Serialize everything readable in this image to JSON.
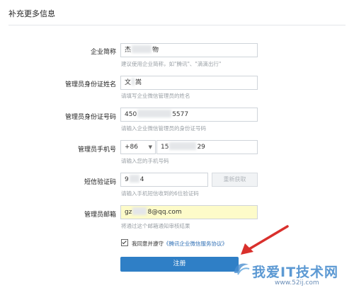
{
  "section": {
    "title": "补充更多信息"
  },
  "fields": {
    "company_name": {
      "label": "企业简称",
      "value_prefix": "杰",
      "value_suffix": "物",
      "hint": "建议使用企业简称，如\"腾讯\"、\"滴滴出行\""
    },
    "admin_name": {
      "label": "管理员身份证姓名",
      "value_prefix": "文",
      "value_suffix": "嵩",
      "hint": "请填写企业微信管理员的姓名"
    },
    "admin_id": {
      "label": "管理员身份证号码",
      "value_prefix": "450",
      "value_suffix": "5577",
      "hint": "请输入企业微信管理员的身份证号码"
    },
    "admin_phone": {
      "label": "管理员手机号",
      "country_code": "+86",
      "value_prefix": "15",
      "value_suffix": "29",
      "hint": "请输入您的手机号码"
    },
    "sms_code": {
      "label": "短信验证码",
      "value_prefix": "9",
      "value_suffix": "4",
      "resend_label": "重新获取",
      "hint": "请输入手机短信收到的6位验证码"
    },
    "admin_email": {
      "label": "管理员邮箱",
      "value_prefix": "gz",
      "value_suffix": "8@qq.com",
      "hint": "将通过这个邮箱通知审核结果"
    }
  },
  "agreement": {
    "prefix": "我同意并遵守",
    "link_text": "《腾讯企业微信服务协议》"
  },
  "submit_label": "注册",
  "watermark": {
    "text": "我爱IT技术网",
    "url": "www.52ij.com"
  },
  "colors": {
    "primary_button": "#2f7fc6",
    "arrow": "#d9302c",
    "link": "#2f6fb5",
    "autofill_bg": "#fdfbc9"
  }
}
